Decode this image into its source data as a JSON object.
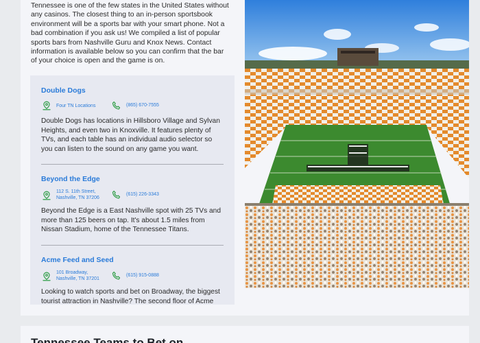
{
  "intro": {
    "text": "Tennessee is one of the few states in the United States without any casinos. The closest thing to an in-person sportsbook environment will be a sports bar with your smart phone. Not a bad combination if you ask us! We compiled a list of popular sports bars from Nashville Guru and Knox News. Contact information is available below so you can confirm that the bar of your choice is open and the game is on."
  },
  "bars": [
    {
      "name": "Double Dogs",
      "address_line1": "Four TN Locations",
      "address_line2": "",
      "phone": "(865) 670-7555",
      "description": "Double Dogs has locations in Hillsboro Village and Sylvan Heights, and even two in Knoxville. It features plenty of TVs, and each table has an individual audio selector so you can listen to the sound on any game you want."
    },
    {
      "name": "Beyond the Edge",
      "address_line1": "112 S. 11th Street,",
      "address_line2": "Nashville, TN 37206",
      "phone": "(615) 226-3343",
      "description": "Beyond the Edge is a East Nashville spot with 25 TVs and more than 125 beers on tap. It's about 1.5 miles from Nissan Stadium, home of the Tennessee Titans."
    },
    {
      "name": "Acme Feed and Seed",
      "address_line1": "101 Broadway,",
      "address_line2": "Nashville, TN 37201",
      "phone": "(615) 915-0888",
      "description": "Looking to watch sports and bet on Broadway, the biggest tourist attraction in Nashville? The second floor of Acme"
    }
  ],
  "next_section": {
    "title": "Tennessee Teams to Bet on"
  },
  "colors": {
    "link_blue": "#2a7bd9",
    "icon_green": "#3aa251",
    "card_bg": "#f4f5f9",
    "list_bg": "#e7e9f1"
  },
  "icons": {
    "location": "map-pin-icon",
    "phone": "phone-icon"
  }
}
